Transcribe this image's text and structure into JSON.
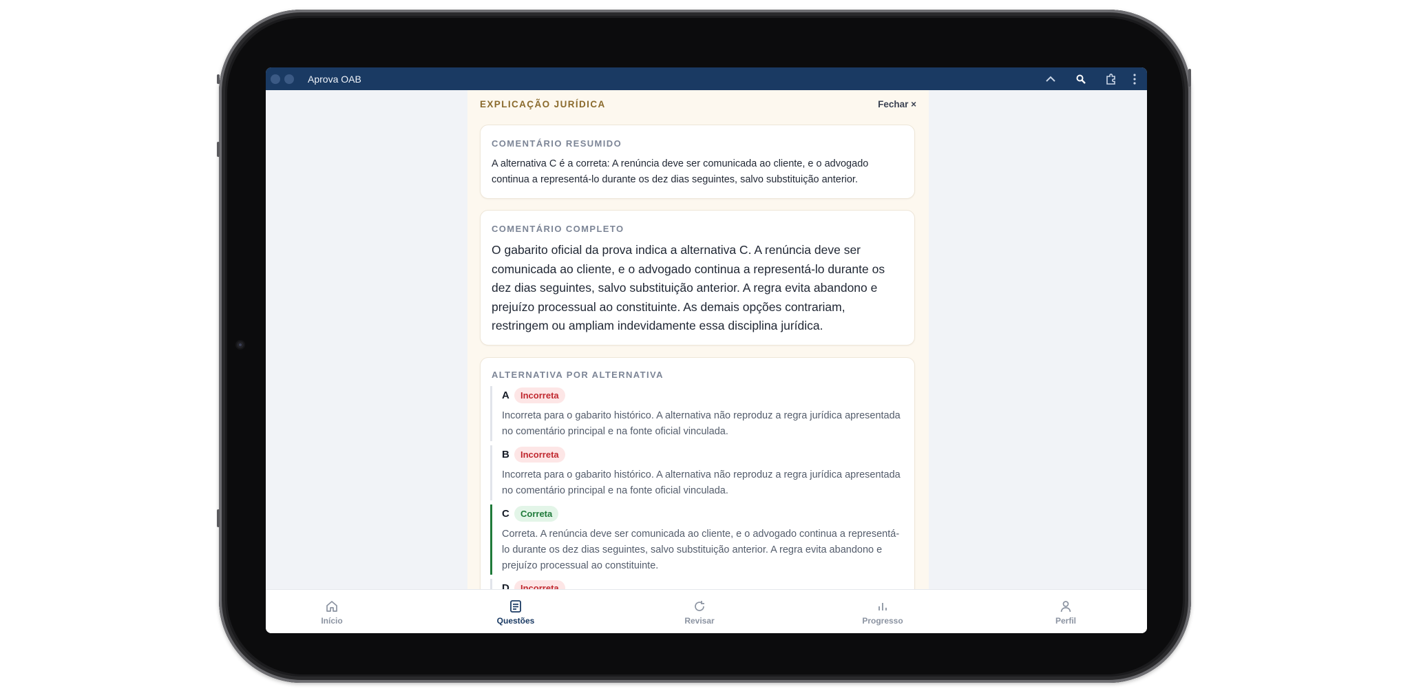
{
  "window": {
    "app_title": "Aprova OAB",
    "icons": [
      "chevron-up-icon",
      "search-icon",
      "extension-icon",
      "more-vert-icon"
    ]
  },
  "panel": {
    "title": "EXPLICAÇÃO JURÍDICA",
    "close_label": "Fechar ×"
  },
  "summary": {
    "label": "COMENTÁRIO RESUMIDO",
    "text": "A alternativa C é a correta: A renúncia deve ser comunicada ao cliente, e o advogado continua a representá-lo durante os dez dias seguintes, salvo substituição anterior."
  },
  "full": {
    "label": "COMENTÁRIO COMPLETO",
    "text": "O gabarito oficial da prova indica a alternativa C. A renúncia deve ser comunicada ao cliente, e o advogado continua a representá-lo durante os dez dias seguintes, salvo substituição anterior. A regra evita abandono e prejuízo processual ao constituinte. As demais opções contrariam, restringem ou ampliam indevidamente essa disciplina jurídica."
  },
  "alternatives": {
    "label": "ALTERNATIVA POR ALTERNATIVA",
    "items": [
      {
        "letter": "A",
        "status": "Incorreta",
        "correct": false,
        "text": "Incorreta para o gabarito histórico. A alternativa não reproduz a regra jurídica apresentada no comentário principal e na fonte oficial vinculada."
      },
      {
        "letter": "B",
        "status": "Incorreta",
        "correct": false,
        "text": "Incorreta para o gabarito histórico. A alternativa não reproduz a regra jurídica apresentada no comentário principal e na fonte oficial vinculada."
      },
      {
        "letter": "C",
        "status": "Correta",
        "correct": true,
        "text": "Correta. A renúncia deve ser comunicada ao cliente, e o advogado continua a representá-lo durante os dez dias seguintes, salvo substituição anterior. A regra evita abandono e prejuízo processual ao constituinte."
      },
      {
        "letter": "D",
        "status": "Incorreta",
        "correct": false,
        "text": ""
      }
    ]
  },
  "nav": {
    "items": [
      {
        "label": "Início",
        "icon": "home-icon",
        "active": false
      },
      {
        "label": "Questões",
        "icon": "questions-icon",
        "active": true
      },
      {
        "label": "Revisar",
        "icon": "refresh-icon",
        "active": false
      },
      {
        "label": "Progresso",
        "icon": "bar-chart-icon",
        "active": false
      },
      {
        "label": "Perfil",
        "icon": "person-icon",
        "active": false
      }
    ]
  },
  "colors": {
    "titlebar": "#1a3a63",
    "accent_gold": "#8a6a2c",
    "correct_green": "#1f7a3a",
    "incorrect_red": "#c0282f"
  }
}
